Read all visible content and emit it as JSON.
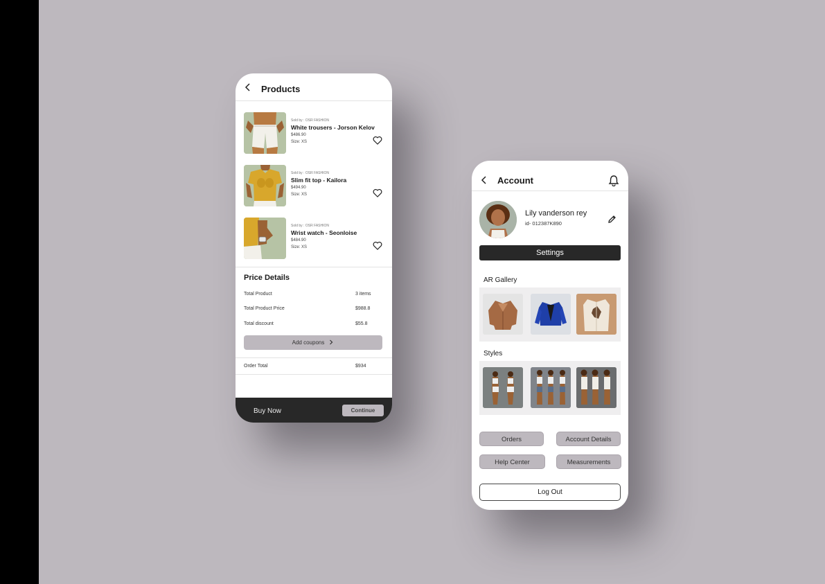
{
  "products_screen": {
    "title": "Products",
    "items": [
      {
        "seller": "Sold by : OSR FASHION",
        "name": "White trousers - Jorson Kelov",
        "price": "$486.90",
        "size": "Size: XS"
      },
      {
        "seller": "Sold by : OSR FASHION",
        "name": "Slim fit top - Kailora",
        "price": "$494.90",
        "size": "Size: XS"
      },
      {
        "seller": "Sold by : OSR FASHION",
        "name": "Wrist watch - Seonloise",
        "price": "$484.90",
        "size": "Size: XS"
      }
    ],
    "price_details": {
      "title": "Price Details",
      "rows": [
        {
          "label": "Total Product",
          "value": "3 items"
        },
        {
          "label": "Total Product Price",
          "value": "$988.8"
        },
        {
          "label": "Total discount",
          "value": "$55.8"
        }
      ],
      "coupon_label": "Add coupons",
      "order_total_label": "Order Total",
      "order_total_value": "$934"
    },
    "footer": {
      "buy_label": "Buy Now",
      "continue_label": "Continue"
    }
  },
  "account_screen": {
    "title": "Account",
    "user_name": "Lily vanderson rey",
    "user_id": "id- 012387K890",
    "settings_label": "Settings",
    "ar_gallery_label": "AR Gallery",
    "styles_label": "Styles",
    "buttons": {
      "orders": "Orders",
      "account_details": "Account Details",
      "help_center": "Help Center",
      "measurements": "Measurements"
    },
    "logout_label": "Log Out"
  },
  "colors": {
    "background": "#bdb8be",
    "dark": "#282828",
    "accent_pill": "#bdb8be"
  },
  "icons": [
    "chevron-left-icon",
    "heart-icon",
    "chevron-right-icon",
    "bell-icon",
    "pencil-icon"
  ]
}
